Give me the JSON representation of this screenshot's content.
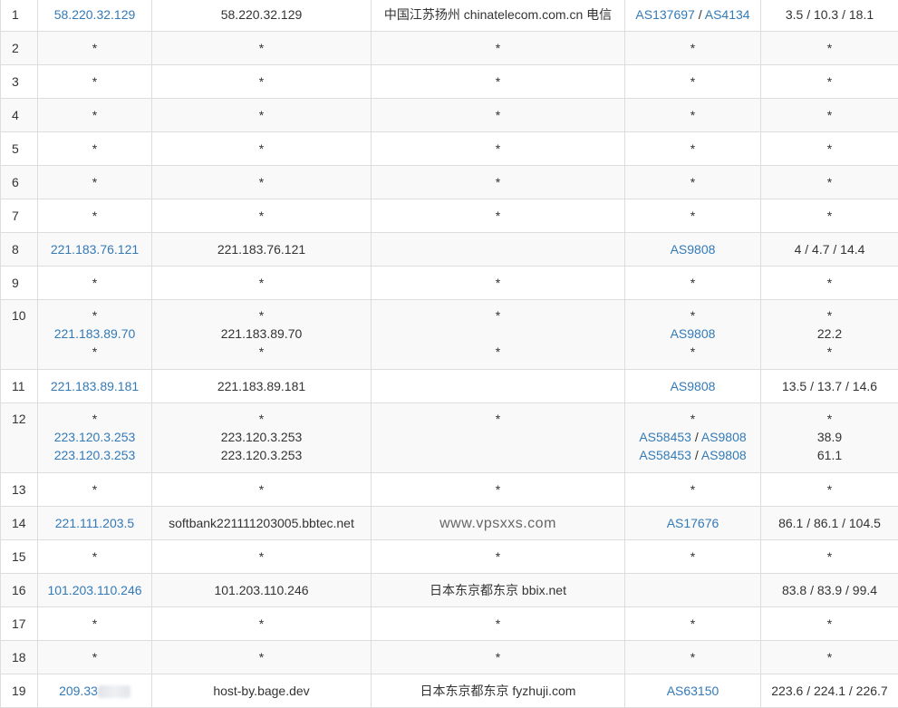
{
  "trace": {
    "rows": [
      {
        "hop": "1",
        "ip": "58.220.32.129",
        "host": "58.220.32.129",
        "geo": "中国江苏扬州 chinatelecom.com.cn 电信",
        "asn": [
          "AS137697",
          "AS4134"
        ],
        "rtt": "3.5 / 10.3 / 18.1"
      },
      {
        "hop": "2",
        "ip": "*",
        "host": "*",
        "geo": "*",
        "asn": "*",
        "rtt": "*"
      },
      {
        "hop": "3",
        "ip": "*",
        "host": "*",
        "geo": "*",
        "asn": "*",
        "rtt": "*"
      },
      {
        "hop": "4",
        "ip": "*",
        "host": "*",
        "geo": "*",
        "asn": "*",
        "rtt": "*"
      },
      {
        "hop": "5",
        "ip": "*",
        "host": "*",
        "geo": "*",
        "asn": "*",
        "rtt": "*"
      },
      {
        "hop": "6",
        "ip": "*",
        "host": "*",
        "geo": "*",
        "asn": "*",
        "rtt": "*"
      },
      {
        "hop": "7",
        "ip": "*",
        "host": "*",
        "geo": "*",
        "asn": "*",
        "rtt": "*"
      },
      {
        "hop": "8",
        "ip": "221.183.76.121",
        "host": "221.183.76.121",
        "geo": "",
        "asn": "AS9808",
        "rtt": "4 / 4.7 / 14.4"
      },
      {
        "hop": "9",
        "ip": "*",
        "host": "*",
        "geo": "*",
        "asn": "*",
        "rtt": "*"
      },
      {
        "hop": "10",
        "lines": [
          {
            "ip": "*",
            "host": "*",
            "geo": "*",
            "asn": "*",
            "rtt": "*"
          },
          {
            "ip": "221.183.89.70",
            "host": "221.183.89.70",
            "geo": "",
            "asn": "AS9808",
            "rtt": "22.2"
          },
          {
            "ip": "*",
            "host": "*",
            "geo": "*",
            "asn": "*",
            "rtt": "*"
          }
        ]
      },
      {
        "hop": "11",
        "ip": "221.183.89.181",
        "host": "221.183.89.181",
        "geo": "",
        "asn": "AS9808",
        "rtt": "13.5 / 13.7 / 14.6"
      },
      {
        "hop": "12",
        "lines": [
          {
            "ip": "*",
            "host": "*",
            "geo": "*",
            "asn": "*",
            "rtt": "*"
          },
          {
            "ip": "223.120.3.253",
            "host": "223.120.3.253",
            "geo": "",
            "asn": [
              "AS58453",
              "AS9808"
            ],
            "rtt": "38.9"
          },
          {
            "ip": "223.120.3.253",
            "host": "223.120.3.253",
            "geo": "",
            "asn": [
              "AS58453",
              "AS9808"
            ],
            "rtt": "61.1"
          }
        ]
      },
      {
        "hop": "13",
        "ip": "*",
        "host": "*",
        "geo": "*",
        "asn": "*",
        "rtt": "*"
      },
      {
        "hop": "14",
        "ip": "221.111.203.5",
        "host": "softbank221111203005.bbtec.net",
        "geo": "",
        "asn": "AS17676",
        "rtt": "86.1 / 86.1 / 104.5"
      },
      {
        "hop": "15",
        "ip": "*",
        "host": "*",
        "geo": "*",
        "asn": "*",
        "rtt": "*"
      },
      {
        "hop": "16",
        "ip": "101.203.110.246",
        "host": "101.203.110.246",
        "geo": "日本东京都东京 bbix.net",
        "asn": "",
        "rtt": "83.8 / 83.9 / 99.4"
      },
      {
        "hop": "17",
        "ip": "*",
        "host": "*",
        "geo": "*",
        "asn": "*",
        "rtt": "*"
      },
      {
        "hop": "18",
        "ip": "*",
        "host": "*",
        "geo": "*",
        "asn": "*",
        "rtt": "*"
      },
      {
        "hop": "19",
        "ip": "209.33",
        "ip_redacted": true,
        "host": "host-by.bage.dev",
        "geo": "日本东京都东京 fyzhuji.com",
        "asn": "AS63150",
        "rtt": "223.6 / 224.1 / 226.7"
      }
    ]
  },
  "watermark": "www.vpsxxs.com",
  "colors": {
    "link": "#337ab7",
    "border": "#dddddd",
    "stripe": "#f9f9f9",
    "text": "#333333"
  }
}
